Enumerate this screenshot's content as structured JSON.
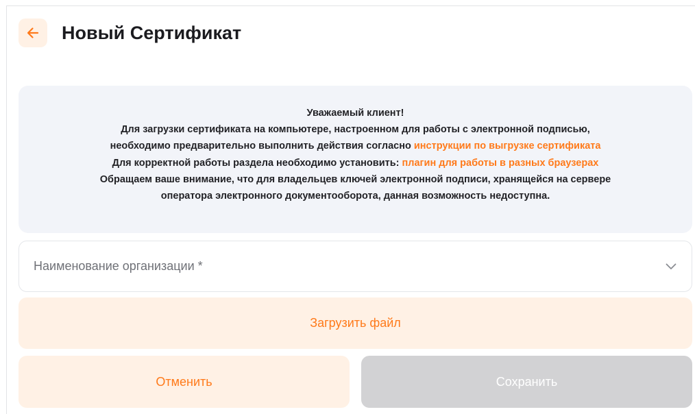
{
  "header": {
    "title": "Новый Сертификат",
    "back_icon": "arrow-left-icon"
  },
  "notice": {
    "greeting": "Уважаемый клиент!",
    "line1": "Для загрузки сертификата на компьютере, настроенном для работы с электронной подписью,",
    "line2_text": "необходимо предварительно выполнить действия согласно ",
    "line2_link": "инструкции по выгрузке сертификата",
    "line3_text": "Для корректной работы раздела необходимо установить: ",
    "line3_link": "плагин для работы в разных браузерах",
    "line4": "Обращаем ваше внимание, что для владельцев ключей электронной подписи, хранящейся на сервере",
    "line5": "оператора электронного документооборота, данная возможность недоступна."
  },
  "form": {
    "organization_placeholder": "Наименование организации *",
    "dropdown_icon": "chevron-down-icon",
    "upload_label": "Загрузить файл",
    "cancel_label": "Отменить",
    "save_label": "Сохранить"
  },
  "colors": {
    "accent": "#ff7a1a",
    "accent_soft": "#fff1e5",
    "notice_bg": "#f2f4f9",
    "disabled_bg": "#d2d2d4",
    "title_text": "#1b1b1f"
  }
}
